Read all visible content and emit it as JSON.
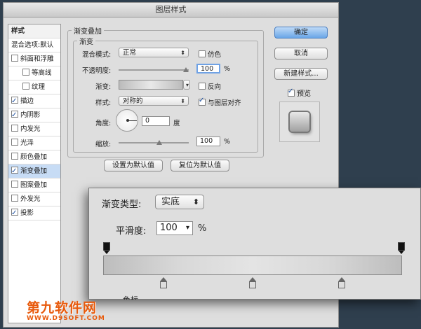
{
  "window": {
    "title": "图层样式"
  },
  "sidebar": {
    "header": "样式",
    "blend_default": "混合选项:默认",
    "items": [
      {
        "label": "斜面和浮雕",
        "checked": false,
        "sub": false
      },
      {
        "label": "等高线",
        "checked": false,
        "sub": true
      },
      {
        "label": "纹理",
        "checked": false,
        "sub": true
      },
      {
        "label": "描边",
        "checked": true,
        "sub": false
      },
      {
        "label": "内阴影",
        "checked": true,
        "sub": false
      },
      {
        "label": "内发光",
        "checked": false,
        "sub": false
      },
      {
        "label": "光泽",
        "checked": false,
        "sub": false
      },
      {
        "label": "颜色叠加",
        "checked": false,
        "sub": false
      },
      {
        "label": "渐变叠加",
        "checked": true,
        "sub": false,
        "selected": true
      },
      {
        "label": "图案叠加",
        "checked": false,
        "sub": false
      },
      {
        "label": "外发光",
        "checked": false,
        "sub": false
      },
      {
        "label": "投影",
        "checked": true,
        "sub": false
      }
    ]
  },
  "panel": {
    "title": "渐变叠加",
    "subtitle": "渐变",
    "blend_mode_label": "混合模式:",
    "blend_mode_value": "正常",
    "dither_label": "仿色",
    "opacity_label": "不透明度:",
    "opacity_value": "100",
    "percent": "%",
    "gradient_label": "渐变:",
    "reverse_label": "反向",
    "style_label": "样式:",
    "style_value": "对称的",
    "align_label": "与图层对齐",
    "angle_label": "角度:",
    "angle_value": "0",
    "degree": "度",
    "scale_label": "缩放:",
    "scale_value": "100",
    "set_default_button": "设置为默认值",
    "reset_default_button": "复位为默认值"
  },
  "actions": {
    "ok": "确定",
    "cancel": "取消",
    "new_style": "新建样式...",
    "preview_label": "预览"
  },
  "zoom_panel": {
    "gradient_type_label": "渐变类型:",
    "gradient_type_value": "实底",
    "smoothness_label": "平滑度:",
    "smoothness_value": "100",
    "percent": "%",
    "cut_text": "色标"
  },
  "watermark": {
    "line1": "第九软件网",
    "line2": "WWW.D9SOFT.COM"
  }
}
